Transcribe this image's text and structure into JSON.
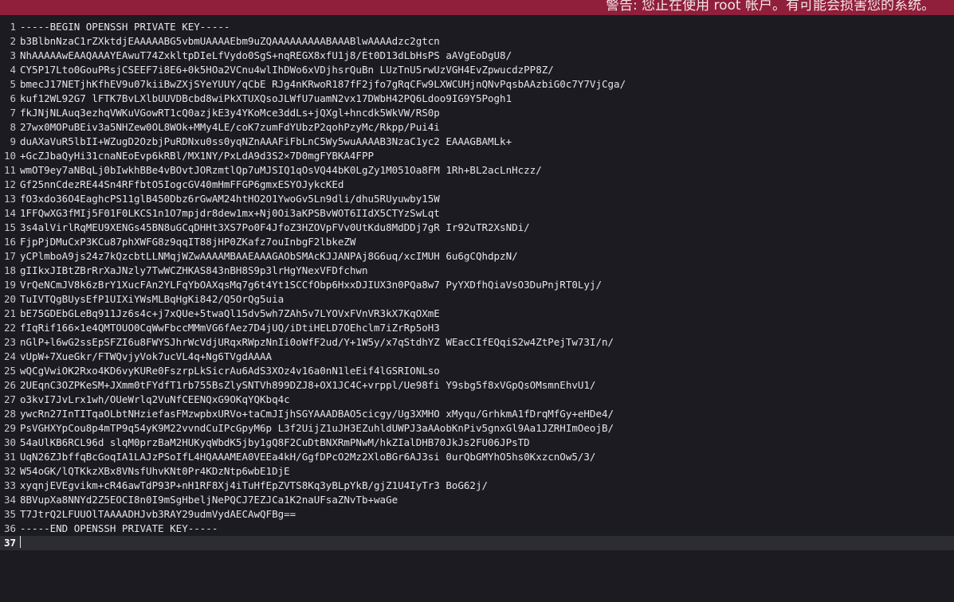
{
  "warning_bar": {
    "text": "警告: 您正在使用 root 帐户。有可能会损害您的系统。"
  },
  "editor": {
    "current_line": 37,
    "lines": [
      {
        "num": "1",
        "text": "-----BEGIN OPENSSH PRIVATE KEY-----"
      },
      {
        "num": "2",
        "text": "b3BlbnNzaC1rZXktdjEAAAAABG5vbmUAAAAEbm9uZQAAAAAAAAABAAABlwAAAAdzc2gtcn"
      },
      {
        "num": "3",
        "text": "NhAAAAAwEAAQAAAYEAwuT74ZxkltpDIeLfVydo0SgS+nqREGX8xfU1j8/Et0D13dLbHsPS aAVgEoDgU8/"
      },
      {
        "num": "4",
        "text": "CY5P17Lto0GouPRsjCSEEF7i8E6+0k5HOa2VCnu4wlIhDWo6xVDjhsrQuBn LUzTnU5rwUzVGH4EvZpwucdzPP8Z/"
      },
      {
        "num": "5",
        "text": "bmecJ17NETjhKfhEV9u07kiiBwZXjSYeYUUY/qCbE RJg4nKRwoR187fF2jfo7gRqCFw9LXWCUHjnQNvPqsbAAzbiG0c7Y7VjCga/"
      },
      {
        "num": "6",
        "text": "kuf12WL92G7 lFTK7BvLXlbUUVDBcbd8wiPkXTUXQsoJLWfU7uamN2vx17DWbH42PQ6Ldoo9IG9Y5Pogh1"
      },
      {
        "num": "7",
        "text": "fkJNjNLAuq3ezhqVWKuVGowRT1cQ0azjkE3y4YKoMce3ddLs+jQXgl+hncdk5WkVW/RS0p"
      },
      {
        "num": "8",
        "text": "27wx0MOPuBEiv3a5NHZew0OL8WOk+MMy4LE/coK7zumFdYUbzP2qohPzyMc/Rkpp/Pui4i"
      },
      {
        "num": "9",
        "text": "duAXaVuR5lbII+WZugD2OzbjPuRDNxu0ss0yqNZnAAAFiFbLnC5Wy5wuAAAAB3NzaC1yc2 EAAAGBAMLk+"
      },
      {
        "num": "10",
        "text": "+GcZJbaQyHi31cnaNEoEvp6kRBl/MX1NY/PxLdA9d3S2×7D0mgFYBKA4FPP"
      },
      {
        "num": "11",
        "text": "wmOT9ey7aNBqLj0bIwkhBBe4vBOvtJORzmtlQp7uMJSIQ1qOsVQ44bK0LgZy1M051Oa8FM 1Rh+BL2acLnHczz/"
      },
      {
        "num": "12",
        "text": "Gf25nnCdezRE44Sn4RFfbtO5IogcGV40mHmFFGP6gmxESYOJykcKEd"
      },
      {
        "num": "13",
        "text": "fO3xdo36O4EaghcPS11glB450Dbz6rGwAM24htHO2O1YwoGv5Ln9dli/dhu5RUyuwby15W"
      },
      {
        "num": "14",
        "text": "1FFQwXG3fMIj5F01F0LKCS1n1O7mpjdr8dew1mx+Nj0Oi3aKPSBvWOT6IIdX5CTYzSwLqt"
      },
      {
        "num": "15",
        "text": "3s4alVirlRqMEU9XENGs45BN8uGCqDHHt3XS7Po0F4JfoZ3HZOVpFVv0UtKdu8MdDDj7gR Ir92uTR2XsNDi/"
      },
      {
        "num": "16",
        "text": "FjpPjDMuCxP3KCu87phXWFG8z9qqIT88jHP0ZKafz7ouInbgF2lbkeZW"
      },
      {
        "num": "17",
        "text": "yCPlmboA9js24z7kQzcbtLLNMqjWZwAAAAMBAAEAAAGAObSMAcKJJANPAj8G6uq/xcIMUH 6u6gCQhdpzN/"
      },
      {
        "num": "18",
        "text": "gIIkxJIBtZBrRrXaJNzly7TwWCZHKAS843nBH8S9p3lrHgYNexVFDfchwn"
      },
      {
        "num": "19",
        "text": "VrQeNCmJV8k6zBrY1XucFAn2YLFqYbOAXqsMq7g6t4Yt1SCCfObp6HxxDJIUX3n0PQa8w7 PyYXDfhQiaVsO3DuPnjRT0Lyj/"
      },
      {
        "num": "20",
        "text": "TuIVTQgBUysEfP1UIXiYWsMLBqHgKi842/Q5OrQg5uia"
      },
      {
        "num": "21",
        "text": "bE75GDEbGLeBq911Jz6s4c+j7xQUe+5twaQl15dv5wh7ZAh5v7LYOVxFVnVR3kX7KqOXmE"
      },
      {
        "num": "22",
        "text": "fIqRif166×1e4QMTOUO0CqWwFbccMMmVG6fAez7D4jUQ/iDtiHELD7OEhclm7iZrRp5oH3"
      },
      {
        "num": "23",
        "text": "nGlP+l6wG2ssEpSFZI6u8FWYSJhrWcVdjURqxRWpzNnIi0oWfF2ud/Y+1W5y/x7qStdhYZ WEacCIfEQqiS2w4ZtPejTw73I/n/"
      },
      {
        "num": "24",
        "text": "vUpW+7XueGkr/FTWQvjyVok7ucVL4q+Ng6TVgdAAAA"
      },
      {
        "num": "25",
        "text": "wQCgVwiOK2Rxo4KD6vyKURe0FszrpLkSicrAu6AdS3XOz4v16a0nN1leEif4lGSRIONLso"
      },
      {
        "num": "26",
        "text": "2UEqnC3OZPKeSM+JXmm0tFYdfT1rb755BsZlySNTVh899DZJ8+OX1JC4C+vrppl/Ue98fi Y9sbg5f8xVGpQsOMsmnEhvU1/"
      },
      {
        "num": "27",
        "text": "o3kvI7JvLrx1wh/OUeWrlq2VuNfCEENQxG9OKqYQKbq4c"
      },
      {
        "num": "28",
        "text": "ywcRn27InTITqaOLbtNHziefasFMzwpbxURVo+taCmJIjhSGYAAADBAO5cicgy/Ug3XMHO xMyqu/GrhkmA1fDrqMfGy+eHDe4/"
      },
      {
        "num": "29",
        "text": "PsVGHXYpCou8p4mTP9q54yK9M22vvndCuIPcGpyM6p L3f2UijZ1uJH3EZuhldUWPJ3aAAobKnPiv5gnxGl9Aa1JZRHImOeojB/"
      },
      {
        "num": "30",
        "text": "54aUlKB6RCL96d slqM0przBaM2HUKyqWbdK5jby1gQ8F2CuDtBNXRmPNwM/hkZIalDHB70JkJs2FU06JPsTD"
      },
      {
        "num": "31",
        "text": "UqN26ZJbffqBcGoqIA1LAJzPSoIfL4HQAAAMEA0VEEa4kH/GgfDPcO2Mz2XloBGr6AJ3si 0urQbGMYhO5hs0KxzcnOw5/3/"
      },
      {
        "num": "32",
        "text": "W54oGK/lQTKkzXBx8VNsfUhvKNt0Pr4KDzNtp6wbE1DjE"
      },
      {
        "num": "33",
        "text": "xyqnjEVEgvikm+cR46awTdP93P+nH1RF8Xj4iTuHfEpZVTS8Kq3yBLpYkB/gjZ1U4IyTr3 BoG62j/"
      },
      {
        "num": "34",
        "text": "8BVupXa8NNYd2Z5EOCI8n0I9mSgHbeljNePQCJ7EZJCa1K2naUFsaZNvTb+waGe"
      },
      {
        "num": "35",
        "text": "T7JtrQ2LFUUOlTAAAADHJvb3RAY29udmVydAECAwQFBg=="
      },
      {
        "num": "36",
        "text": "-----END OPENSSH PRIVATE KEY-----"
      },
      {
        "num": "37",
        "text": ""
      }
    ]
  }
}
